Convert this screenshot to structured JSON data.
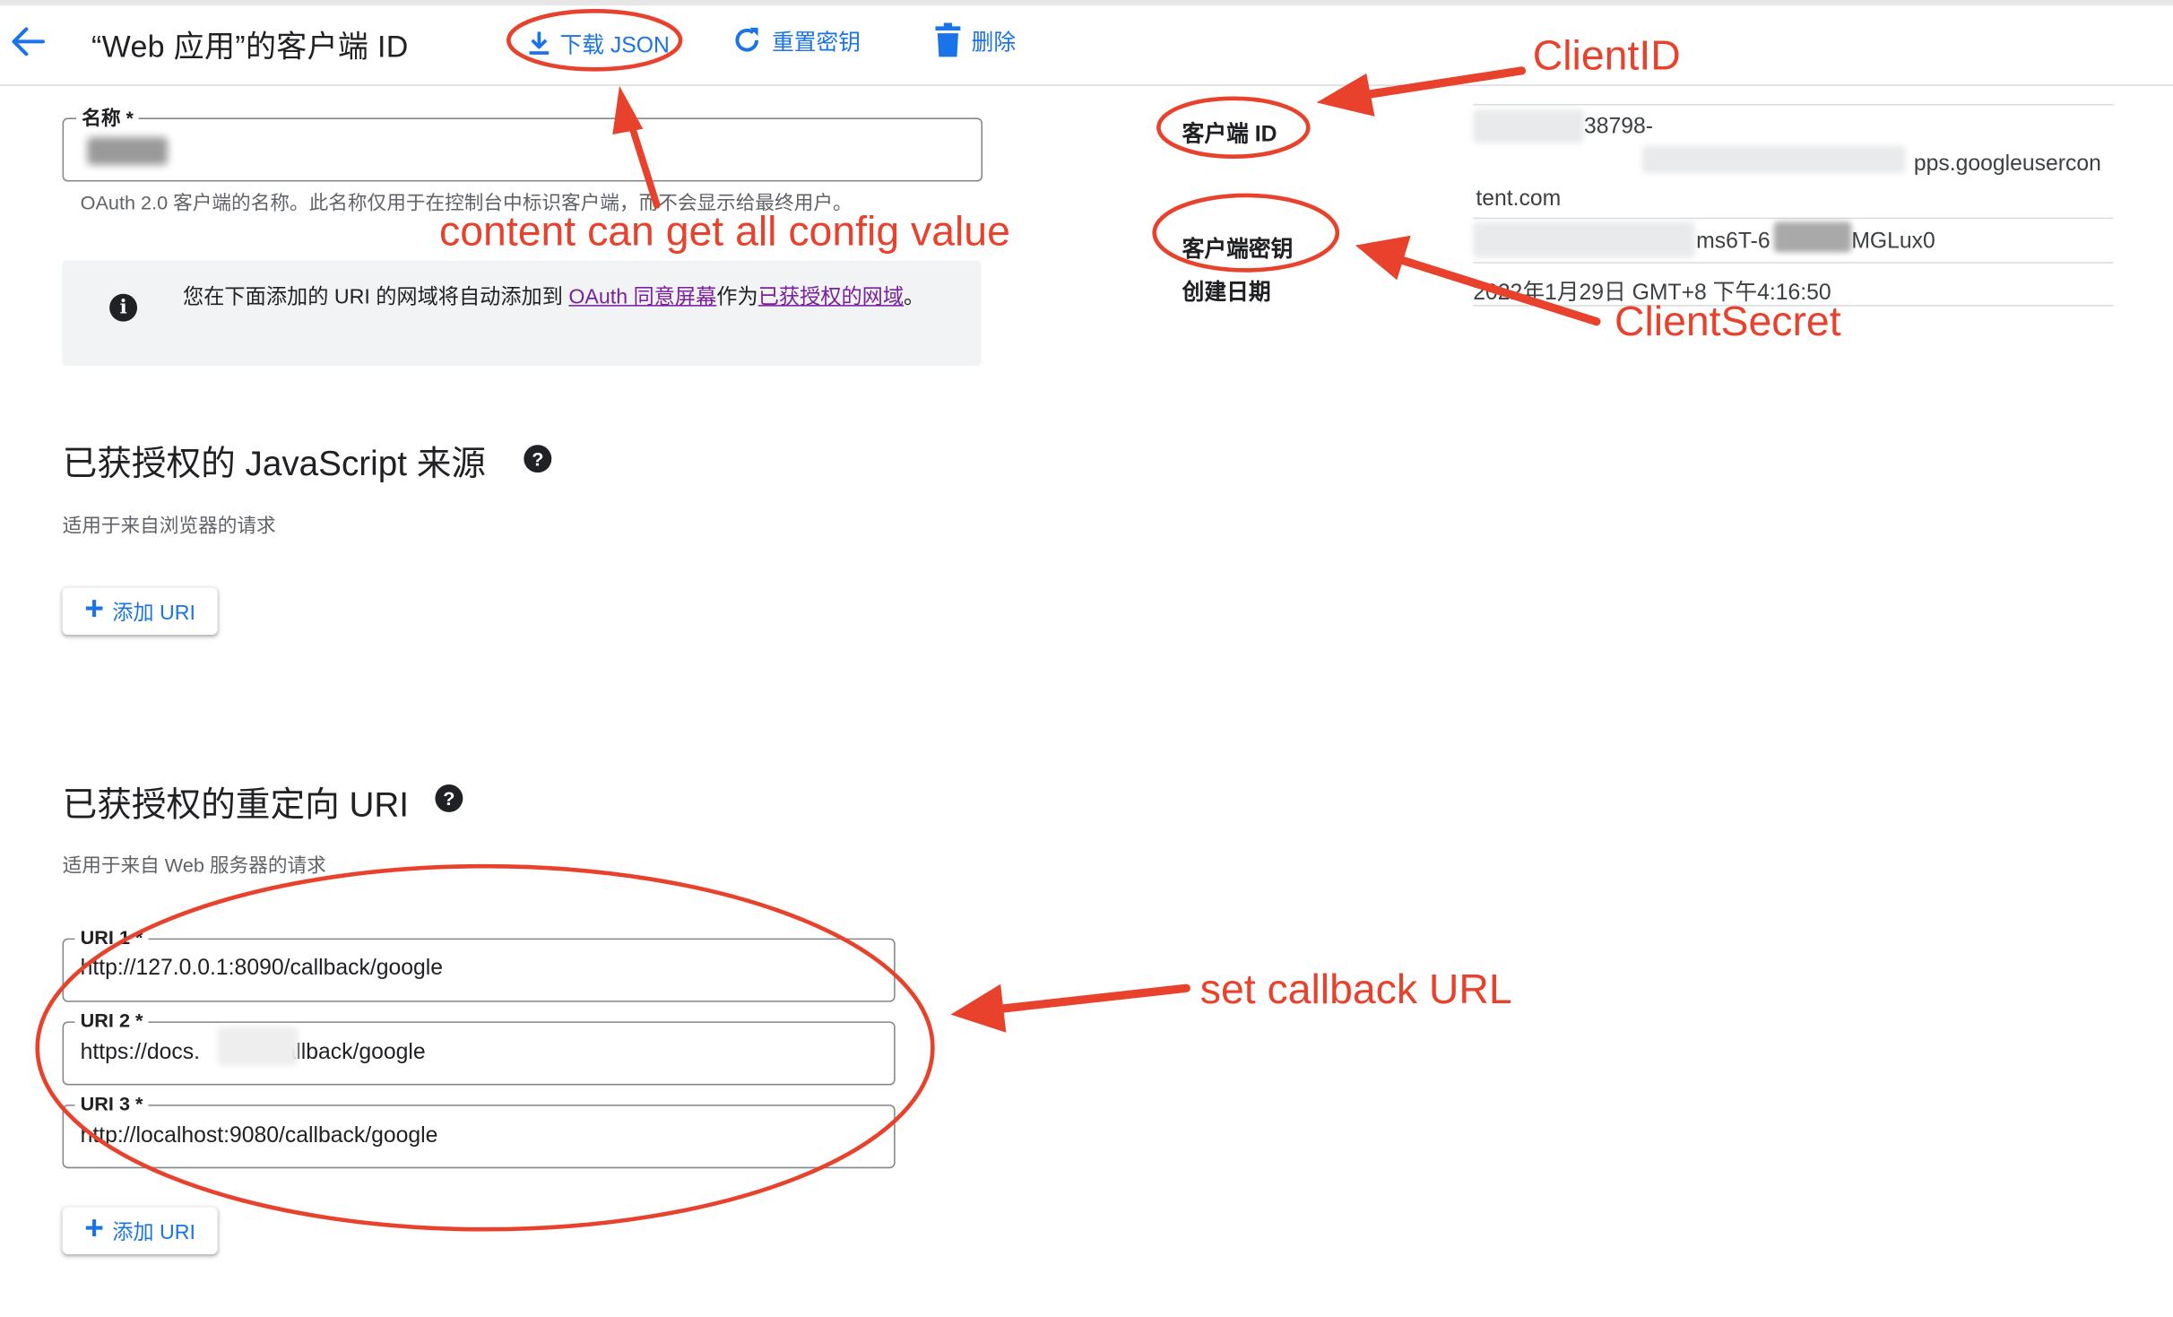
{
  "header": {
    "title": "“Web 应用”的客户端 ID",
    "actions": {
      "download_json": "下载 JSON",
      "reset_secret": "重置密钥",
      "delete": "删除"
    }
  },
  "name_field": {
    "label": "名称 *",
    "helper": "OAuth 2.0 客户端的名称。此名称仅用于在控制台中标识客户端，而不会显示给最终用户。"
  },
  "info_banner": {
    "text_before": "您在下面添加的 URI 的网域将自动添加到 ",
    "link1": "OAuth 同意屏幕",
    "text_middle": "作为",
    "link2": "已获授权的网域",
    "text_after": "。"
  },
  "js_origins": {
    "title": "已获授权的 JavaScript 来源",
    "subtitle": "适用于来自浏览器的请求",
    "add_label": "添加 URI"
  },
  "redirect_uris": {
    "title": "已获授权的重定向 URI",
    "subtitle": "适用于来自 Web 服务器的请求",
    "items": [
      {
        "label": "URI 1 *",
        "value": "http://127.0.0.1:8090/callback/google"
      },
      {
        "label": "URI 2 *",
        "value_prefix": "https://docs.",
        "value_suffix": "/callback/google"
      },
      {
        "label": "URI 3 *",
        "value": "http://localhost:9080/callback/google"
      }
    ],
    "add_label": "添加 URI"
  },
  "details": {
    "client_id_label": "客户端 ID",
    "client_id_line1": "38798-",
    "client_id_line2": "pps.googleusercon",
    "client_id_line3": "tent.com",
    "secret_label": "客户端密钥",
    "secret_part1": "ms6T-6",
    "secret_part2": "MGLux0",
    "created_label": "创建日期",
    "created_value": "2022年1月29日 GMT+8 下午4:16:50"
  },
  "annotations": {
    "client_id": "ClientID",
    "client_secret": "ClientSecret",
    "download_note": "content can get all config value",
    "callback_note": "set callback URL"
  },
  "colors": {
    "accent": "#1a73e8",
    "annotation": "#e8412c",
    "link_visited": "#7b1fa2"
  }
}
